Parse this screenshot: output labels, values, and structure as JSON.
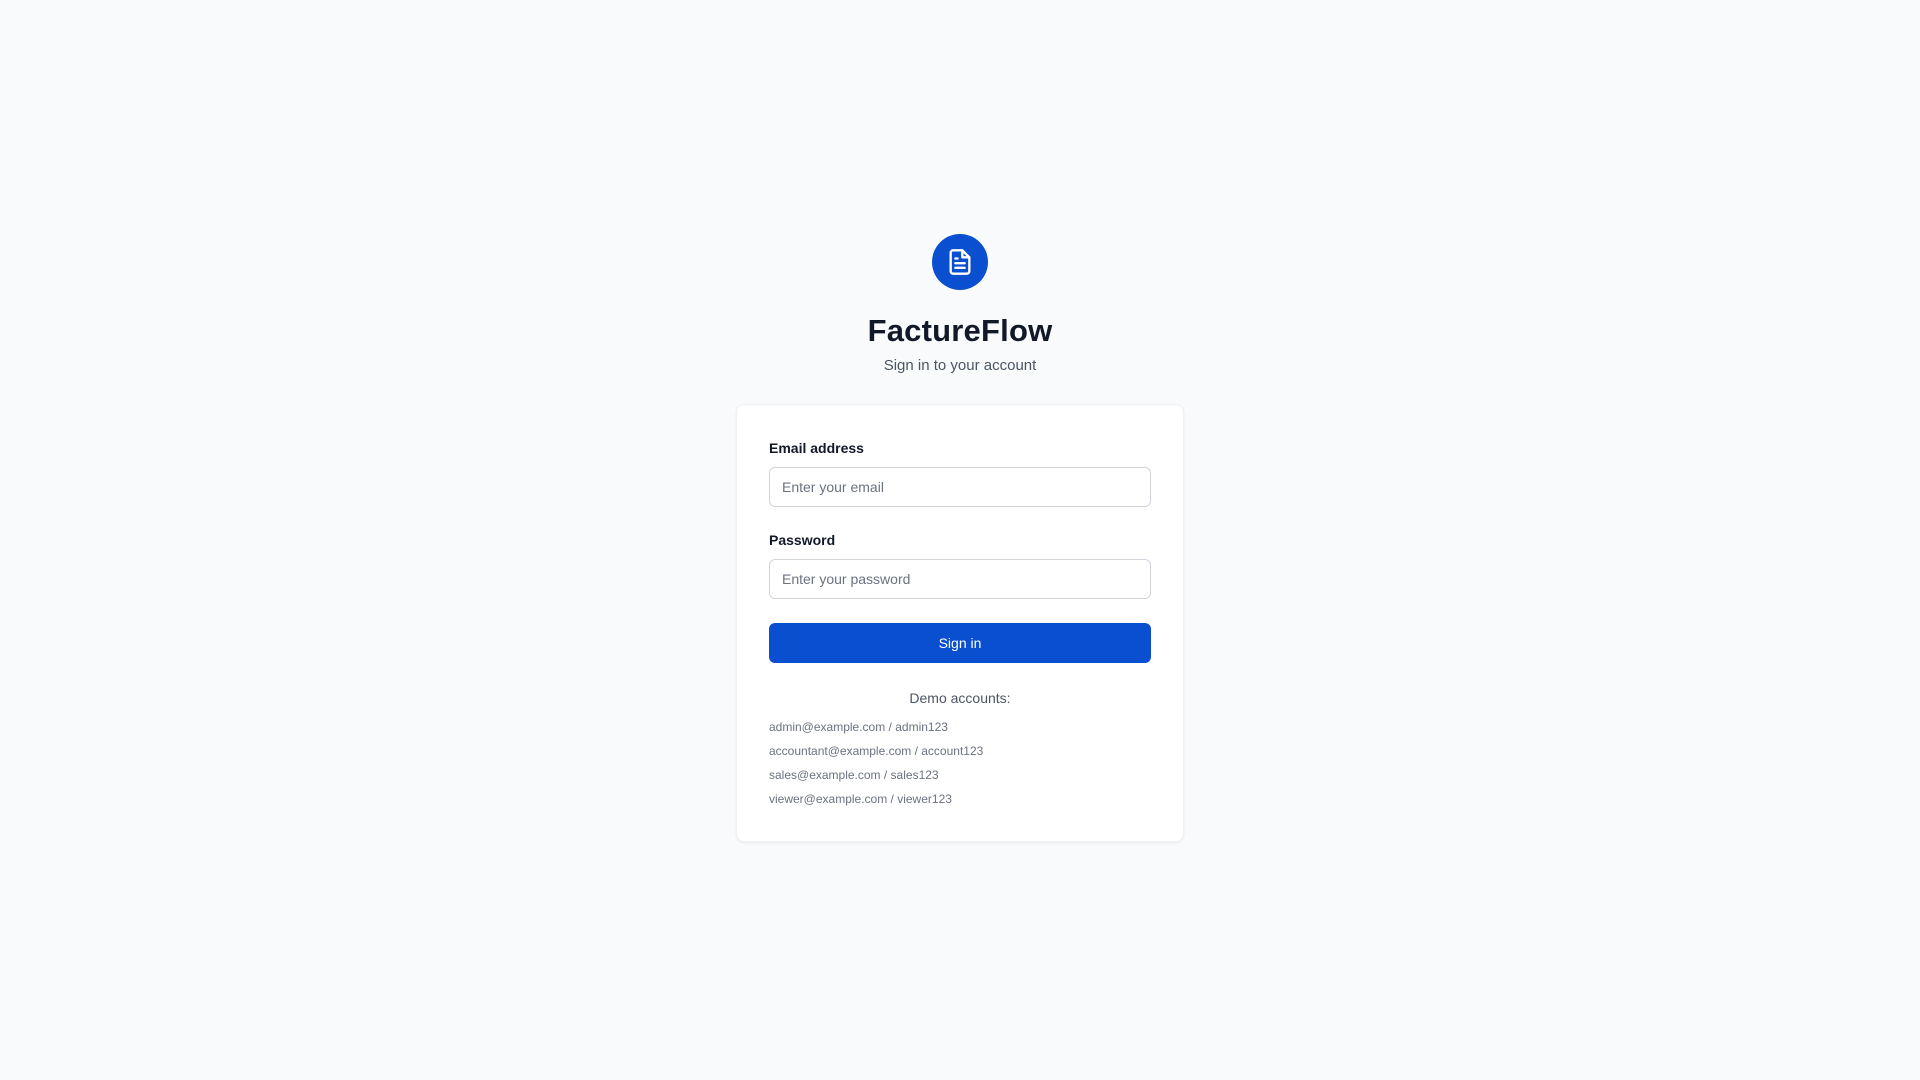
{
  "brand": {
    "name": "FactureFlow",
    "subtitle": "Sign in to your account",
    "logo_icon": "document-icon",
    "accent_color": "#0b4fd1"
  },
  "form": {
    "email": {
      "label": "Email address",
      "placeholder": "Enter your email",
      "value": ""
    },
    "password": {
      "label": "Password",
      "placeholder": "Enter your password",
      "value": ""
    },
    "submit_label": "Sign in"
  },
  "demo": {
    "title": "Demo accounts:",
    "accounts": [
      "admin@example.com / admin123",
      "accountant@example.com / account123",
      "sales@example.com / sales123",
      "viewer@example.com / viewer123"
    ]
  }
}
